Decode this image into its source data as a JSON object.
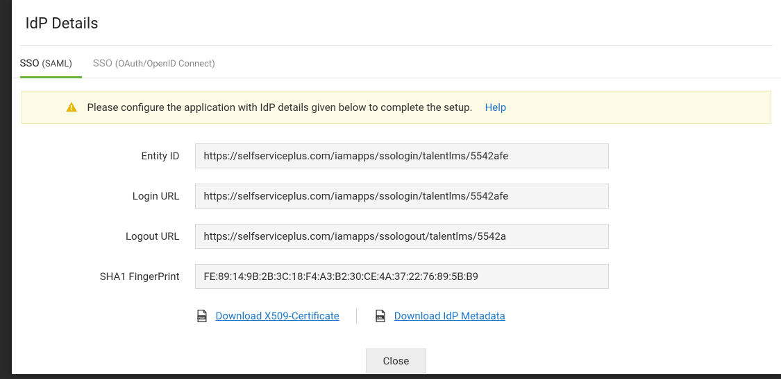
{
  "dialog": {
    "title": "IdP Details"
  },
  "tabs": {
    "saml": {
      "label": "SSO",
      "sub": "(SAML)"
    },
    "oidc": {
      "label": "SSO",
      "sub": "(OAuth/OpenID Connect)"
    }
  },
  "alert": {
    "text": "Please configure the application with IdP details given below to complete the setup.",
    "help": "Help"
  },
  "fields": {
    "entityId": {
      "label": "Entity ID",
      "value": "https://selfserviceplus.com/iamapps/ssologin/talentlms/5542afe"
    },
    "loginUrl": {
      "label": "Login URL",
      "value": "https://selfserviceplus.com/iamapps/ssologin/talentlms/5542afe"
    },
    "logoutUrl": {
      "label": "Logout URL",
      "value": "https://selfserviceplus.com/iamapps/ssologout/talentlms/5542a"
    },
    "sha1": {
      "label": "SHA1 FingerPrint",
      "value": "FE:89:14:9B:2B:3C:18:F4:A3:B2:30:CE:4A:37:22:76:89:5B:B9"
    }
  },
  "downloads": {
    "cert": "Download X509-Certificate",
    "metadata": "Download IdP Metadata"
  },
  "buttons": {
    "close": "Close"
  }
}
